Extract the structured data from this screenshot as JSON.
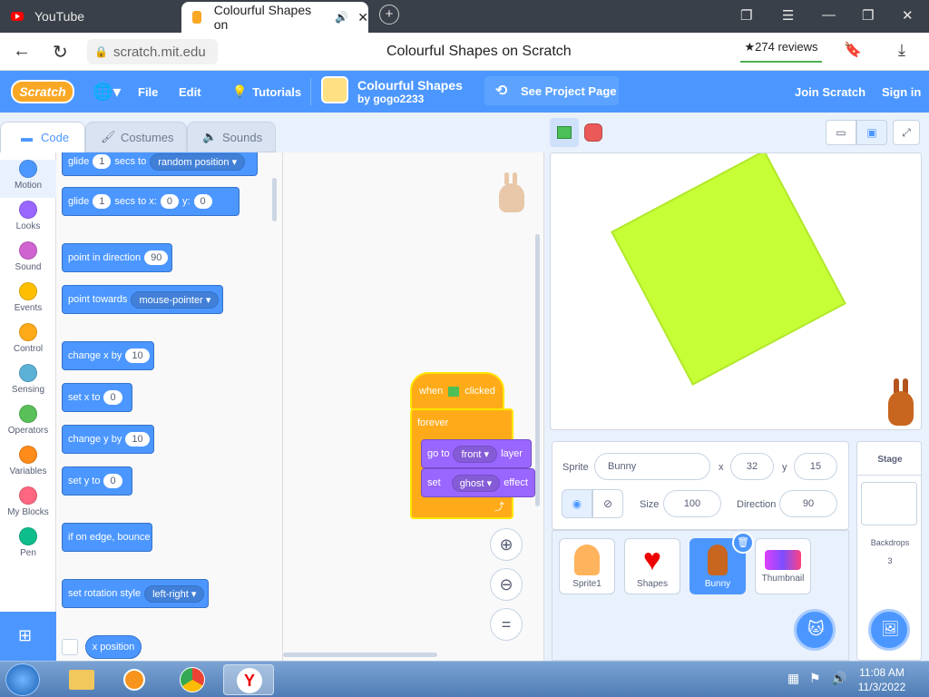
{
  "browser": {
    "tabs": [
      {
        "label": "YouTube"
      },
      {
        "label": "Colourful Shapes on"
      }
    ],
    "url": "scratch.mit.edu",
    "page_title": "Colourful Shapes on Scratch",
    "reviews": "★274 reviews"
  },
  "menubar": {
    "logo": "Scratch",
    "file": "File",
    "edit": "Edit",
    "tutorials": "Tutorials",
    "project_title": "Colourful Shapes",
    "project_author": "by gogo2233",
    "see_project_page": "See Project Page",
    "join": "Join Scratch",
    "signin": "Sign in"
  },
  "editor_tabs": {
    "code": "Code",
    "costumes": "Costumes",
    "sounds": "Sounds"
  },
  "categories": [
    {
      "label": "Motion",
      "color": "#4c97ff"
    },
    {
      "label": "Looks",
      "color": "#9966ff"
    },
    {
      "label": "Sound",
      "color": "#cf63cf"
    },
    {
      "label": "Events",
      "color": "#ffbf00"
    },
    {
      "label": "Control",
      "color": "#ffab19"
    },
    {
      "label": "Sensing",
      "color": "#5cb1d6"
    },
    {
      "label": "Operators",
      "color": "#59c059"
    },
    {
      "label": "Variables",
      "color": "#ff8c1a"
    },
    {
      "label": "My Blocks",
      "color": "#ff6680"
    },
    {
      "label": "Pen",
      "color": "#0fbd8c"
    }
  ],
  "blocks": {
    "glide1": {
      "a": "glide",
      "v": "1",
      "b": "secs to",
      "d": "random position"
    },
    "glide2": {
      "a": "glide",
      "v": "1",
      "b": "secs to x:",
      "x": "0",
      "y_lbl": "y:",
      "y": "0"
    },
    "point_dir": {
      "a": "point in direction",
      "v": "90"
    },
    "point_towards": {
      "a": "point towards",
      "d": "mouse-pointer"
    },
    "change_x": {
      "a": "change x by",
      "v": "10"
    },
    "set_x": {
      "a": "set x to",
      "v": "0"
    },
    "change_y": {
      "a": "change y by",
      "v": "10"
    },
    "set_y": {
      "a": "set y to",
      "v": "0"
    },
    "bounce": {
      "a": "if on edge, bounce"
    },
    "rotation": {
      "a": "set rotation style",
      "d": "left-right"
    },
    "xpos": {
      "a": "x position"
    }
  },
  "script": {
    "when": "when",
    "clicked": "clicked",
    "forever": "forever",
    "goto": "go to",
    "front": "front",
    "layer": "layer",
    "set": "set",
    "ghost": "ghost",
    "effect": "effect"
  },
  "sprite_info": {
    "sprite_label": "Sprite",
    "sprite_name": "Bunny",
    "x_label": "x",
    "x": "32",
    "y_label": "y",
    "y": "15",
    "size_label": "Size",
    "size": "100",
    "direction_label": "Direction",
    "direction": "90"
  },
  "sprites": [
    {
      "name": "Sprite1",
      "selected": false
    },
    {
      "name": "Shapes",
      "selected": false
    },
    {
      "name": "Bunny",
      "selected": true
    },
    {
      "name": "Thumbnail",
      "selected": false
    }
  ],
  "stage_panel": {
    "title": "Stage",
    "backdrops_label": "Backdrops",
    "backdrops_count": "3"
  },
  "taskbar": {
    "time": "11:08 AM",
    "date": "11/3/2022"
  }
}
